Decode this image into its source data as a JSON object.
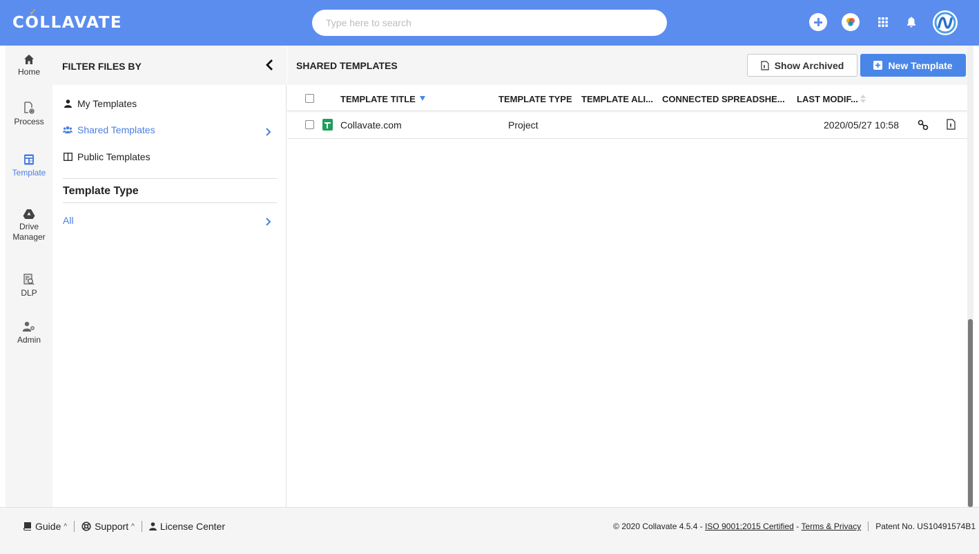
{
  "app": {
    "logo": "COLLAVATE",
    "brand_color": "#5b8def",
    "accent": "#4a86e8"
  },
  "search": {
    "placeholder": "Type here to search"
  },
  "topbar_icons": [
    "plus-circle-icon",
    "color-palette-icon",
    "apps-grid-icon",
    "bell-icon",
    "avatar"
  ],
  "nav": [
    {
      "label": "Home",
      "icon": "home-icon"
    },
    {
      "label": "Process",
      "icon": "process-icon"
    },
    {
      "label": "Template",
      "icon": "template-icon",
      "active": true
    },
    {
      "label": "Drive Manager",
      "icon": "drive-icon"
    },
    {
      "label": "DLP",
      "icon": "dlp-icon"
    },
    {
      "label": "Admin",
      "icon": "admin-icon"
    }
  ],
  "filter": {
    "title": "FILTER FILES BY",
    "items": [
      {
        "label": "My Templates",
        "icon": "user-icon"
      },
      {
        "label": "Shared Templates",
        "icon": "users-icon",
        "active": true
      },
      {
        "label": "Public Templates",
        "icon": "columns-icon"
      }
    ],
    "section_title": "Template Type",
    "type_items": [
      {
        "label": "All",
        "active": true
      }
    ]
  },
  "main": {
    "title": "SHARED TEMPLATES",
    "show_archived_label": "Show Archived",
    "new_template_label": "New Template",
    "columns": [
      "TEMPLATE TITLE",
      "TEMPLATE TYPE",
      "TEMPLATE ALI...",
      "CONNECTED SPREADSHE...",
      "LAST MODIF..."
    ],
    "rows": [
      {
        "title": "Collavate.com",
        "type": "Project",
        "alias": "",
        "spreadsheet": "",
        "last_modified": "2020/05/27 10:58"
      }
    ]
  },
  "footer": {
    "guide": "Guide",
    "support": "Support",
    "license": "License Center",
    "copyright": "© 2020 Collavate 4.5.4 -",
    "iso": "ISO 9001:2015 Certified",
    "dash": "-",
    "terms": "Terms & Privacy",
    "patent": "Patent No. US10491574B1"
  }
}
